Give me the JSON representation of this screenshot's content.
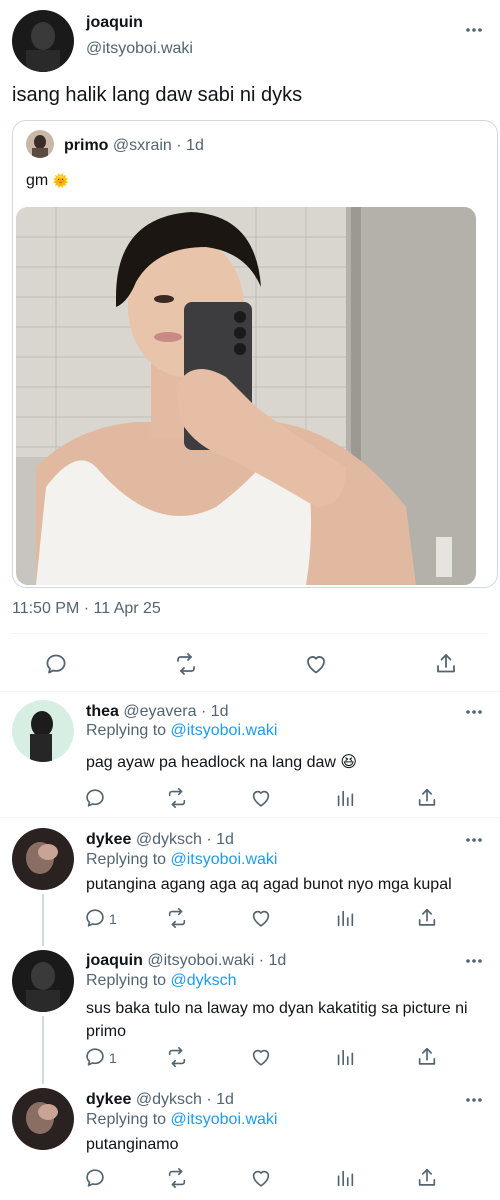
{
  "main_tweet": {
    "author_name": "joaquin",
    "author_handle": "@itsyoboi.waki",
    "text": "isang halik lang daw sabi ni dyks",
    "timestamp": "11:50 PM · 11 Apr 25"
  },
  "quoted_tweet": {
    "author_name": "primo",
    "author_handle": "@sxrain",
    "age": "· 1d",
    "text": "gm",
    "emoji": "🌞"
  },
  "replies": [
    {
      "author_name": "thea",
      "author_handle": "@eyavera",
      "age": "· 1d",
      "replying_label": "Replying to",
      "replying_to": "@itsyoboi.waki",
      "text": "pag ayaw pa headlock na lang daw 😆",
      "reply_count": ""
    },
    {
      "author_name": "dykee",
      "author_handle": "@dyksch",
      "age": "· 1d",
      "replying_label": "Replying to",
      "replying_to": "@itsyoboi.waki",
      "text": "putangina agang aga aq agad bunot nyo mga kupal",
      "reply_count": "1"
    },
    {
      "author_name": "joaquin",
      "author_handle": "@itsyoboi.waki",
      "age": "· 1d",
      "replying_label": "Replying to",
      "replying_to": "@dyksch",
      "text": "sus baka tulo na laway mo dyan kakatitig sa picture ni primo",
      "reply_count": "1"
    },
    {
      "author_name": "dykee",
      "author_handle": "@dyksch",
      "age": "· 1d",
      "replying_label": "Replying to",
      "replying_to": "@itsyoboi.waki",
      "text": "putanginamo",
      "reply_count": ""
    }
  ],
  "colors": {
    "accent": "#1d9bf0",
    "secondary_text": "#536471",
    "divider": "#eff3f4"
  }
}
